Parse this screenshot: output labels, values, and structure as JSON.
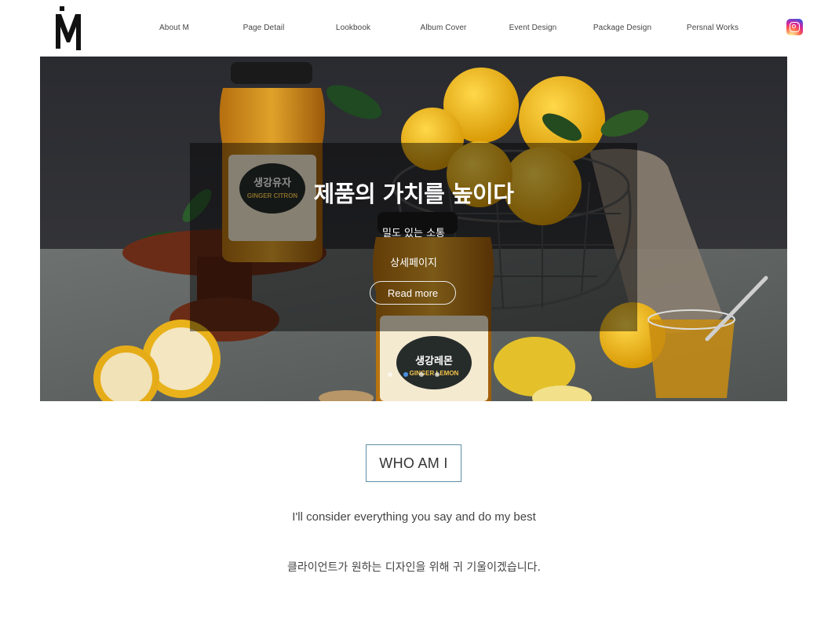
{
  "header": {
    "logo_letter": "M",
    "nav": [
      {
        "label": "About M"
      },
      {
        "label": "Page Detail"
      },
      {
        "label": "Lookbook"
      },
      {
        "label": "Album Cover"
      },
      {
        "label": "Event Design"
      },
      {
        "label": "Package Design"
      },
      {
        "label": "Persnal Works"
      }
    ],
    "social_icon": "instagram-icon"
  },
  "hero": {
    "title": "제품의 가치를 높이다",
    "subtitle1": "밀도 있는 소통",
    "subtitle2": "상세페이지",
    "button_label": "Read more",
    "jar_label_top": "생강유자",
    "jar_label_top_en": "GINGER CITRON",
    "jar_label_bottom": "생강레몬",
    "jar_label_bottom_en": "GINGER LEMON",
    "slides_total": 4,
    "active_slide": 2
  },
  "about": {
    "heading": "WHO AM I",
    "line1": "I'll consider everything you say and do my best",
    "line2": "클라이언트가 원하는 디자인을 위해 귀 기울이겠습니다."
  },
  "colors": {
    "accent_border": "#5f8ea8",
    "active_dot": "#4a90e2"
  }
}
